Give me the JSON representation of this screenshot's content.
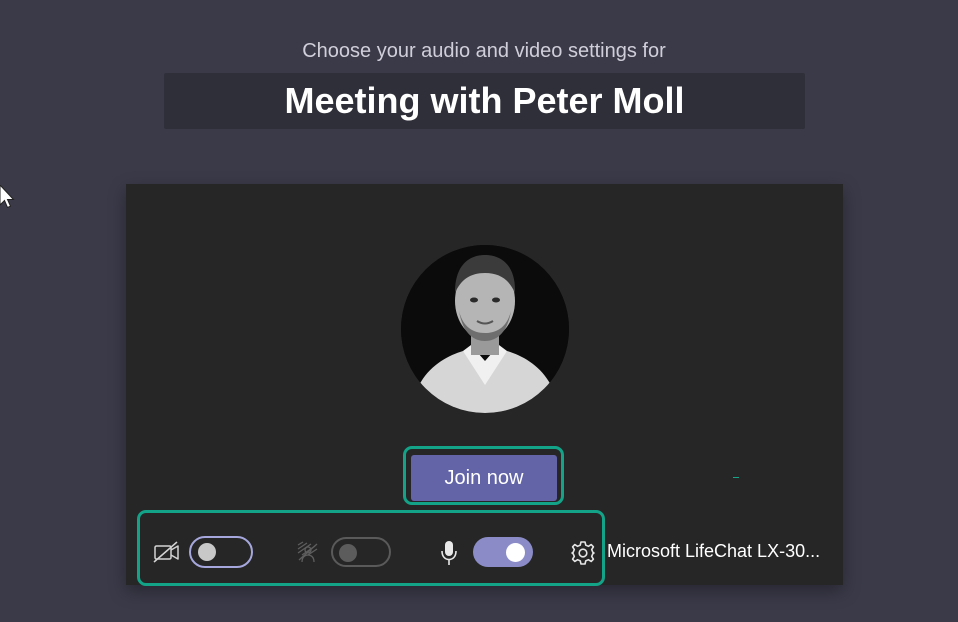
{
  "header": {
    "subtitle": "Choose your audio and video settings for",
    "meeting_title": "Meeting with Peter Moll"
  },
  "preview": {
    "avatar_alt": "Peter Moll"
  },
  "actions": {
    "join_label": "Join now"
  },
  "controls": {
    "camera": {
      "icon": "camera-off-icon",
      "state": "off"
    },
    "background_blur": {
      "icon": "background-blur-icon",
      "state": "off"
    },
    "microphone": {
      "icon": "microphone-icon",
      "state": "on"
    },
    "device_settings": {
      "icon": "gear-icon"
    },
    "audio_device_label": "Microsoft LifeChat LX-30..."
  },
  "colors": {
    "page_background": "#3b3a49",
    "title_box": "#2f2f39",
    "preview_background": "#262626",
    "brand_purple": "#6264a7",
    "toggle_on": "#8b8cc7",
    "highlight_teal": "#13a388"
  }
}
